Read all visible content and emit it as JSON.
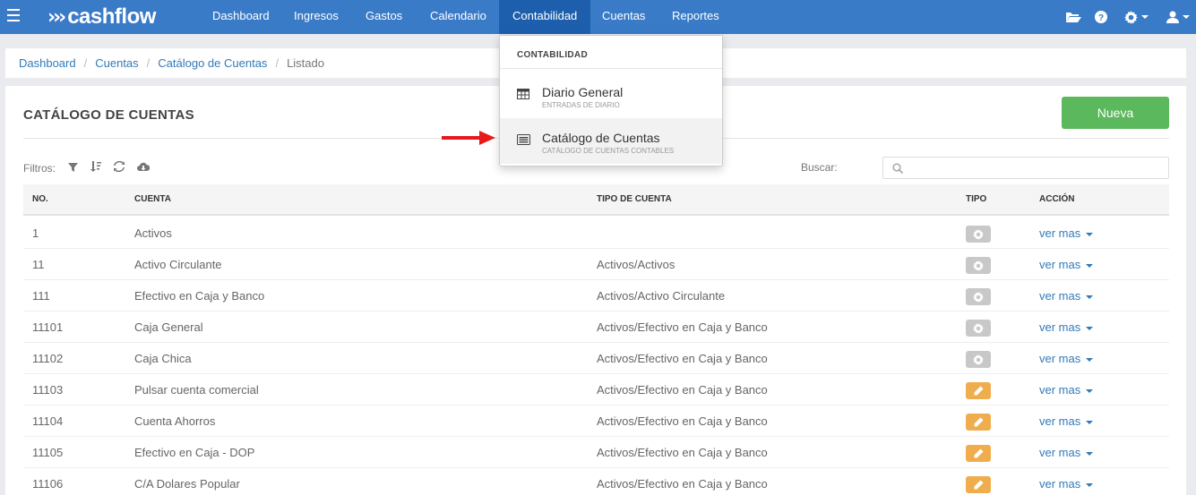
{
  "navbar": {
    "logo_text": "cashflow",
    "items": [
      "Dashboard",
      "Ingresos",
      "Gastos",
      "Calendario",
      "Contabilidad",
      "Cuentas",
      "Reportes"
    ],
    "active_index": 4,
    "color": "#3a7bc8",
    "active_color": "#1e5fad"
  },
  "breadcrumb": {
    "items": [
      "Dashboard",
      "Cuentas",
      "Catálogo de Cuentas"
    ],
    "current": "Listado"
  },
  "panel": {
    "title": "CATÁLOGO DE CUENTAS",
    "new_button": "Nueva",
    "filters_label": "Filtros:",
    "search_label": "Buscar:",
    "search_value": ""
  },
  "table": {
    "headers": [
      "NO.",
      "CUENTA",
      "TIPO DE CUENTA",
      "TIPO",
      "ACCIÓN"
    ],
    "rows": [
      {
        "no": "1",
        "cuenta": "Activos",
        "tipo_cuenta": "",
        "tipo": "gear",
        "accion": "ver mas"
      },
      {
        "no": "11",
        "cuenta": "Activo Circulante",
        "tipo_cuenta": "Activos/Activos",
        "tipo": "gear",
        "accion": "ver mas"
      },
      {
        "no": "111",
        "cuenta": "Efectivo en Caja y Banco",
        "tipo_cuenta": "Activos/Activo Circulante",
        "tipo": "gear",
        "accion": "ver mas"
      },
      {
        "no": "11101",
        "cuenta": "Caja General",
        "tipo_cuenta": "Activos/Efectivo en Caja y Banco",
        "tipo": "gear",
        "accion": "ver mas"
      },
      {
        "no": "11102",
        "cuenta": "Caja Chica",
        "tipo_cuenta": "Activos/Efectivo en Caja y Banco",
        "tipo": "gear",
        "accion": "ver mas"
      },
      {
        "no": "11103",
        "cuenta": "Pulsar cuenta comercial",
        "tipo_cuenta": "Activos/Efectivo en Caja y Banco",
        "tipo": "edit",
        "accion": "ver mas"
      },
      {
        "no": "11104",
        "cuenta": "Cuenta Ahorros",
        "tipo_cuenta": "Activos/Efectivo en Caja y Banco",
        "tipo": "edit",
        "accion": "ver mas"
      },
      {
        "no": "11105",
        "cuenta": "Efectivo en Caja - DOP",
        "tipo_cuenta": "Activos/Efectivo en Caja y Banco",
        "tipo": "edit",
        "accion": "ver mas"
      },
      {
        "no": "11106",
        "cuenta": "C/A Dolares Popular",
        "tipo_cuenta": "Activos/Efectivo en Caja y Banco",
        "tipo": "edit",
        "accion": "ver mas"
      }
    ]
  },
  "dropdown": {
    "header": "CONTABILIDAD",
    "items": [
      {
        "label": "Diario General",
        "sub": "ENTRADAS DE DIARIO",
        "icon": "table-icon"
      },
      {
        "label": "Catálogo de Cuentas",
        "sub": "CATÁLOGO DE CUENTAS CONTABLES",
        "icon": "list-alt-icon"
      }
    ],
    "highlight_index": 1
  },
  "colors": {
    "green": "#5cb85c",
    "orange": "#f0ad4e",
    "gray_btn": "#c8c8c8",
    "link": "#337ab7",
    "arrow": "#e8191a"
  }
}
